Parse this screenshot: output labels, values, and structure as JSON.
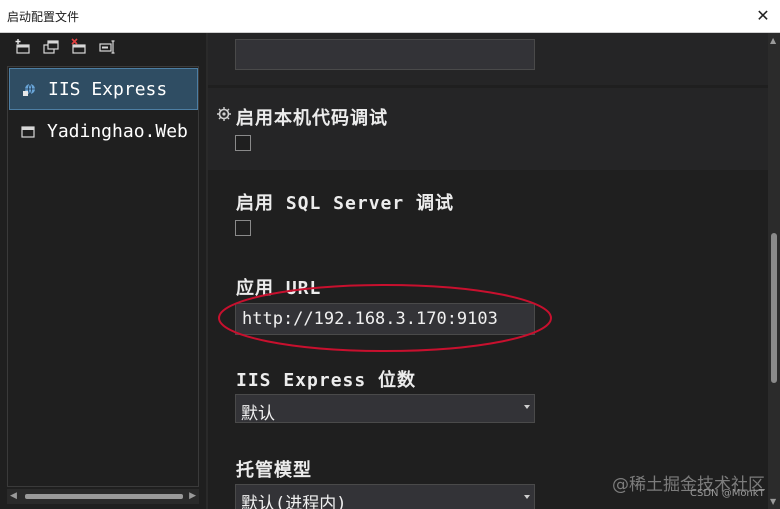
{
  "window": {
    "title": "启动配置文件",
    "close_glyph": "✕"
  },
  "toolbar": {
    "icons": [
      "new-profile-icon",
      "copy-profile-icon",
      "delete-profile-icon",
      "rename-profile-icon"
    ]
  },
  "profiles": [
    {
      "label": "IIS Express",
      "icon": "iis-express-icon",
      "selected": true
    },
    {
      "label": "Yadinghao.Web",
      "icon": "project-icon",
      "selected": false
    }
  ],
  "settings": {
    "native_debug": {
      "label": "启用本机代码调试",
      "checked": false
    },
    "sql_debug": {
      "label": "启用 SQL Server 调试",
      "checked": false
    },
    "app_url": {
      "label": "应用 URL",
      "value": "http://192.168.3.170:9103"
    },
    "iis_bitness": {
      "label": "IIS Express 位数",
      "value": "默认"
    },
    "hosting_model": {
      "label": "托管模型",
      "value": "默认(进程内)"
    }
  },
  "annotation": {
    "color": "#c8102e"
  },
  "watermark": {
    "main": "@稀土掘金技术社区",
    "sub": "CSDN @MonkT"
  },
  "colors": {
    "accent_selection": "#2f4d63",
    "background": "#1f1f1f"
  }
}
